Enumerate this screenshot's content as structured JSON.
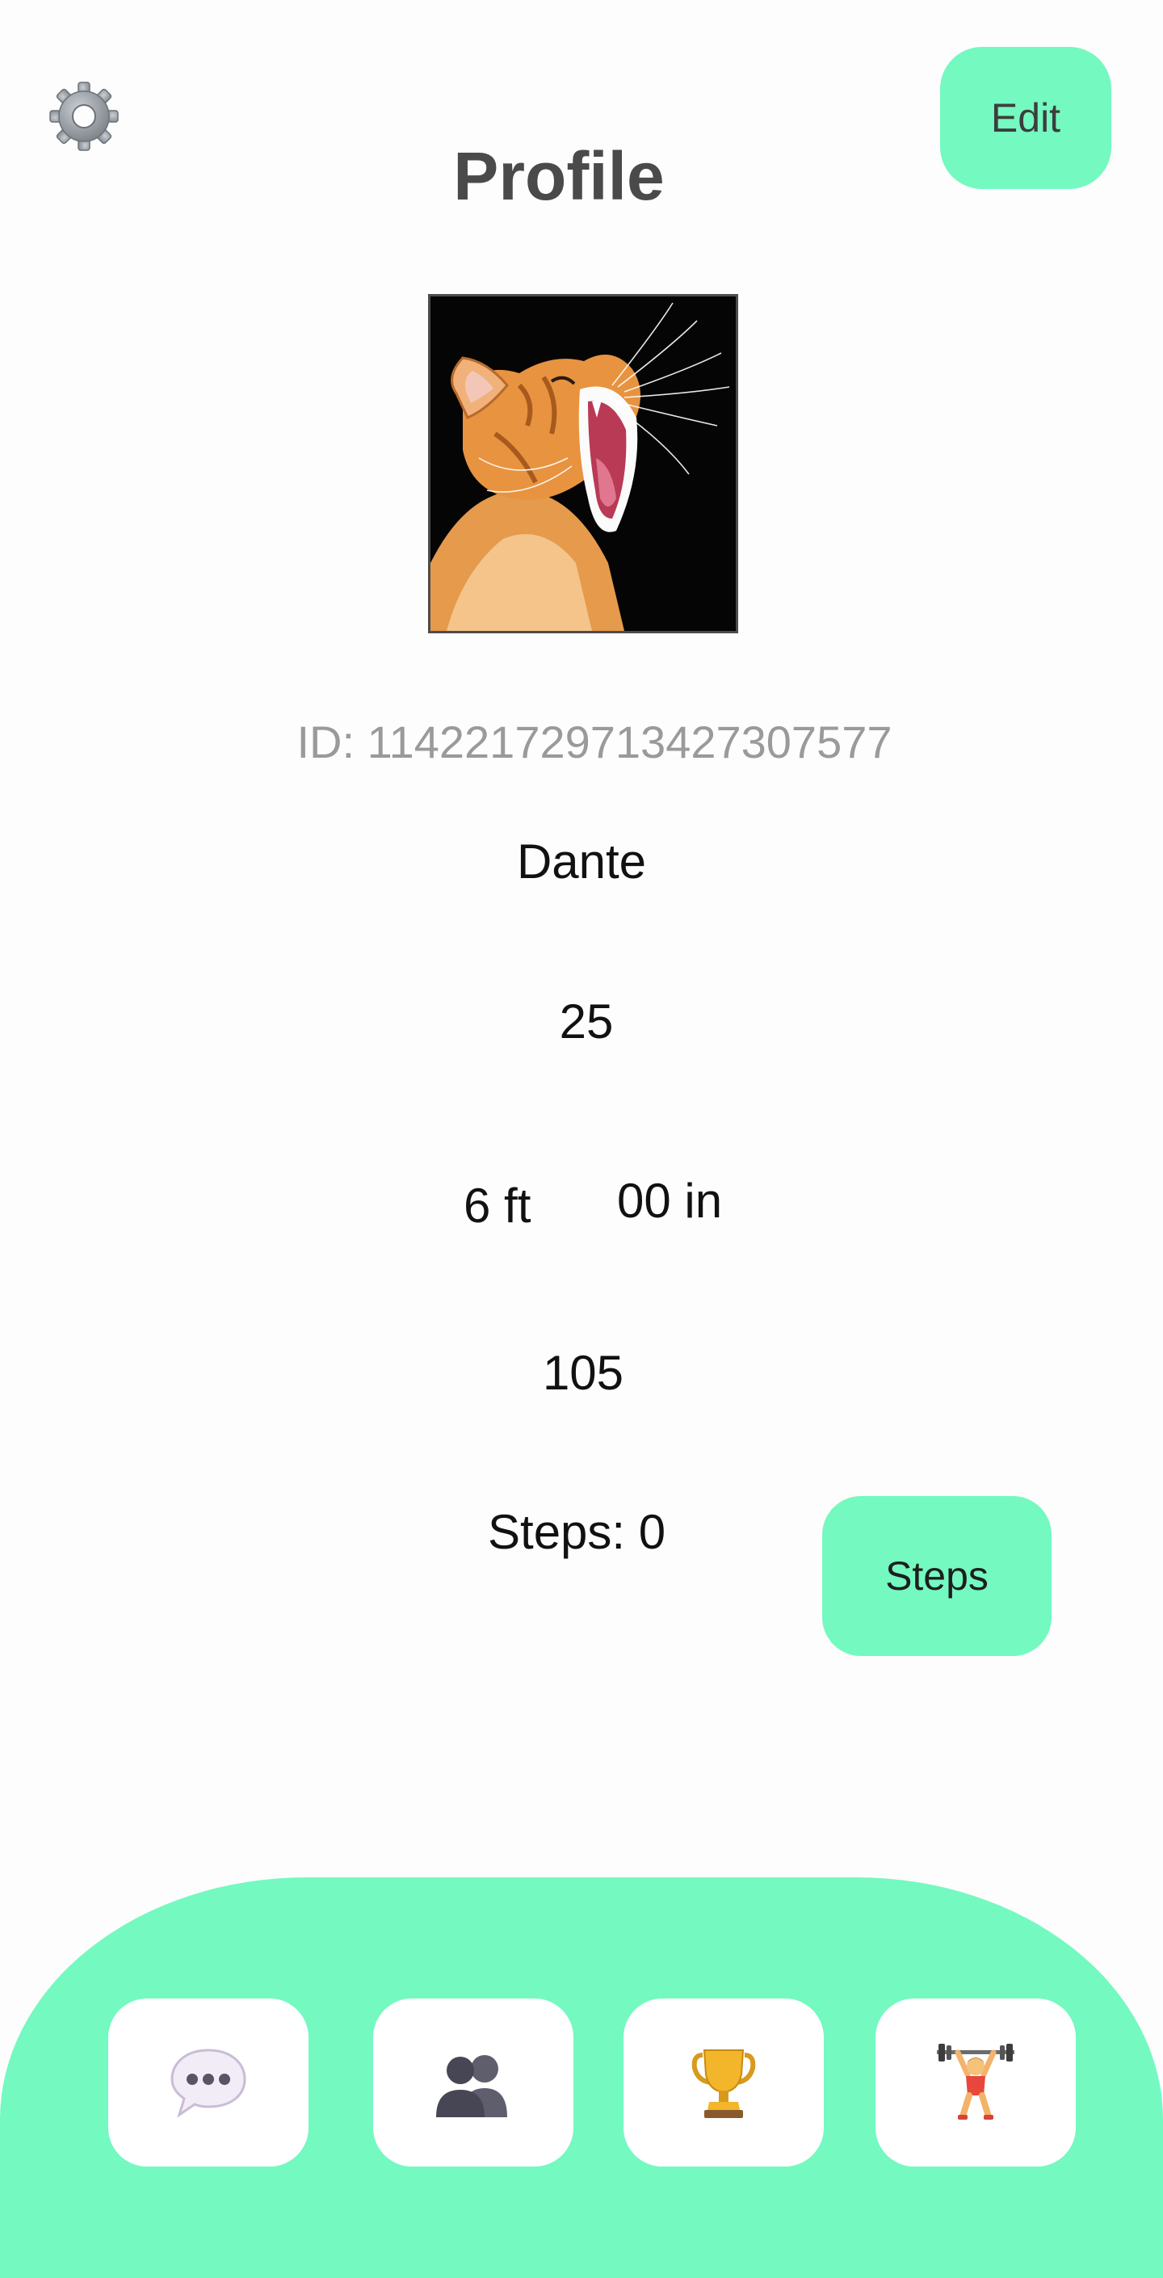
{
  "header": {
    "settings_icon": "gear-icon",
    "title": "Profile",
    "edit_label": "Edit"
  },
  "profile": {
    "avatar": "cat-photo",
    "id_text": "ID: 114221729713427307577",
    "name": "Dante",
    "age": "25",
    "height_ft": "6 ft",
    "height_in": "00 in",
    "weight": "105",
    "steps_text": "Steps: 0",
    "steps_button_label": "Steps"
  },
  "bottom_nav": {
    "items": [
      {
        "icon": "speech-bubble-icon"
      },
      {
        "icon": "people-icon"
      },
      {
        "icon": "trophy-icon"
      },
      {
        "icon": "weightlifter-icon"
      }
    ]
  },
  "colors": {
    "accent": "#74f9c0",
    "background": "#fdfdfd",
    "title": "#4a4a4a",
    "id_text": "#9a9a9a"
  }
}
